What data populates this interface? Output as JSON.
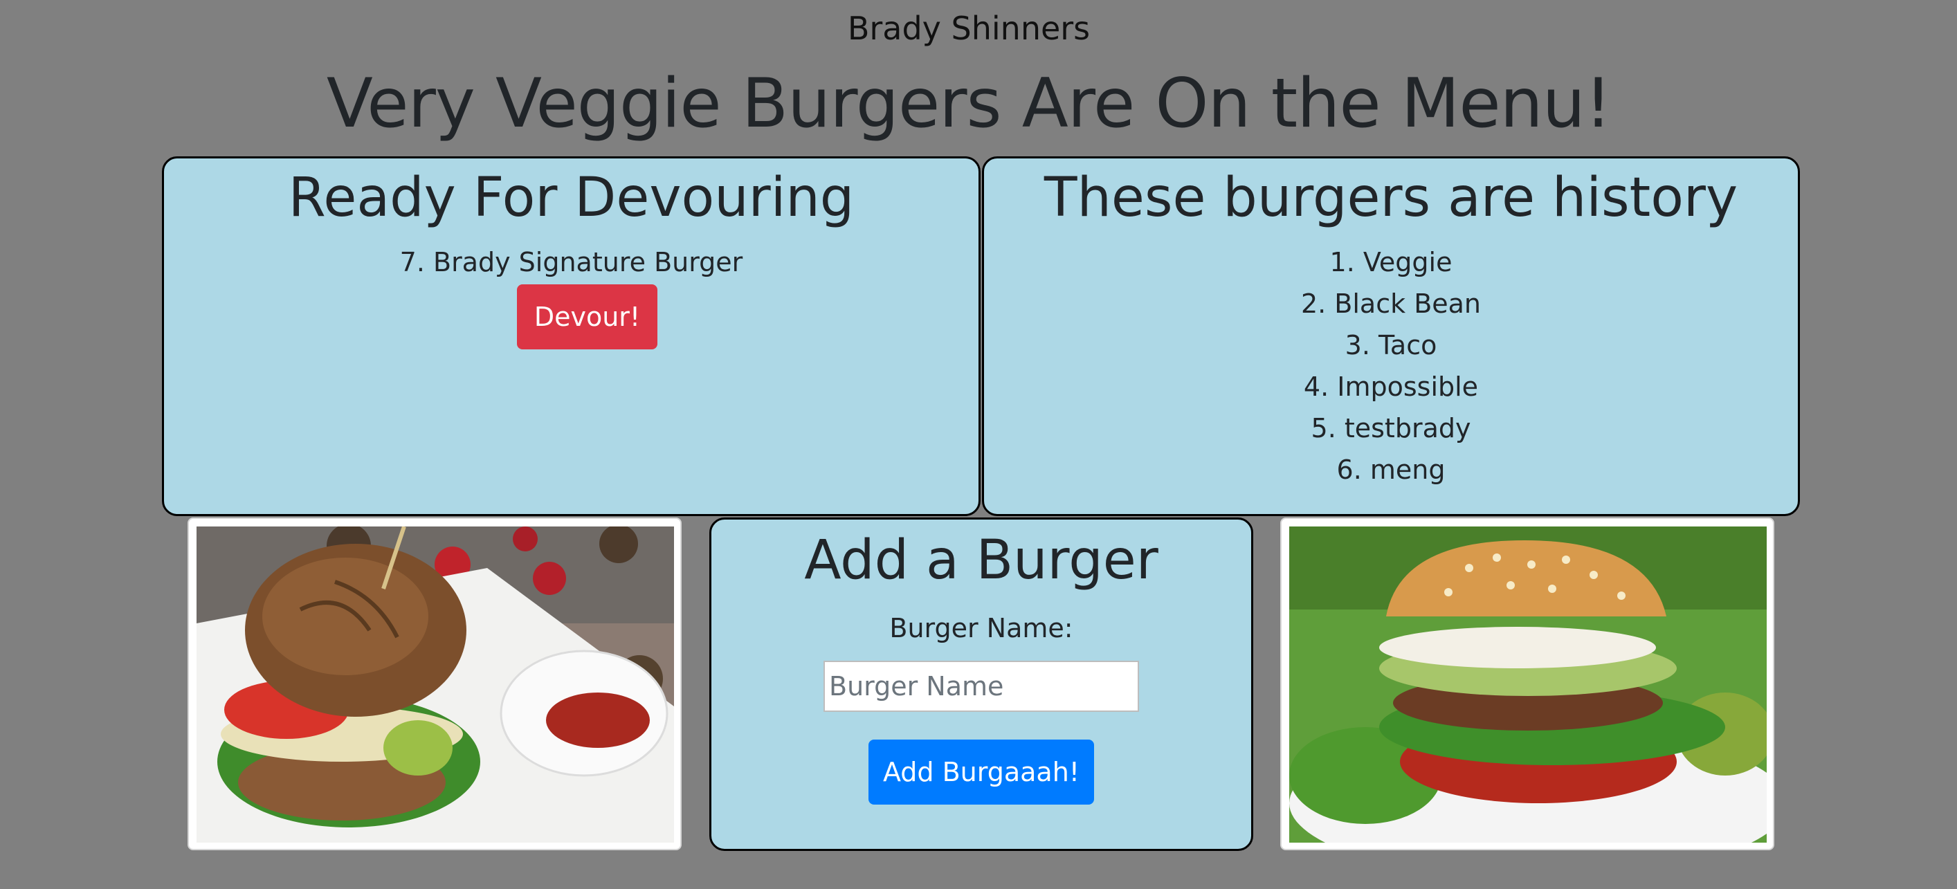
{
  "header": {
    "author": "Brady Shinners",
    "title": "Very Veggie Burgers Are On the Menu!"
  },
  "ready": {
    "title": "Ready For Devouring",
    "items": [
      {
        "label": "7. Brady Signature Burger",
        "button": "Devour!"
      }
    ]
  },
  "history": {
    "title": "These burgers are history",
    "items": [
      "1. Veggie",
      "2. Black Bean",
      "3. Taco",
      "4. Impossible",
      "5. testbrady",
      "6. meng"
    ]
  },
  "add_form": {
    "title": "Add a Burger",
    "label": "Burger Name:",
    "placeholder": "Burger Name",
    "value": "",
    "submit_label": "Add Burgaaah!"
  },
  "colors": {
    "background": "#808080",
    "panel": "#add8e6",
    "devour_button": "#dc3545",
    "add_button": "#007bff"
  }
}
